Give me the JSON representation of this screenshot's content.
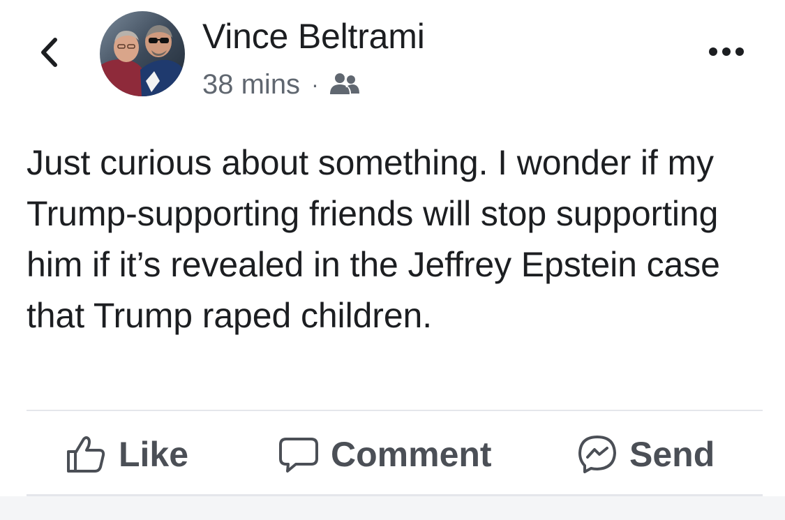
{
  "post": {
    "author": "Vince Beltrami",
    "time": "38 mins",
    "separator": "·",
    "audience_icon": "friends-icon",
    "text": "Just curious about something. I wonder if my Trump-supporting friends will stop supporting him if it’s revealed in the Jeffrey Epstein case that Trump raped children."
  },
  "nav": {
    "back_icon": "chevron-left-icon",
    "more_icon": "more-horizontal-icon"
  },
  "actions": {
    "like_label": "Like",
    "comment_label": "Comment",
    "send_label": "Send",
    "like_icon": "thumbs-up-icon",
    "comment_icon": "speech-bubble-icon",
    "send_icon": "messenger-icon"
  },
  "colors": {
    "text": "#1c1e21",
    "secondary": "#606770",
    "action": "#4b4f56",
    "divider": "#e4e6eb"
  }
}
